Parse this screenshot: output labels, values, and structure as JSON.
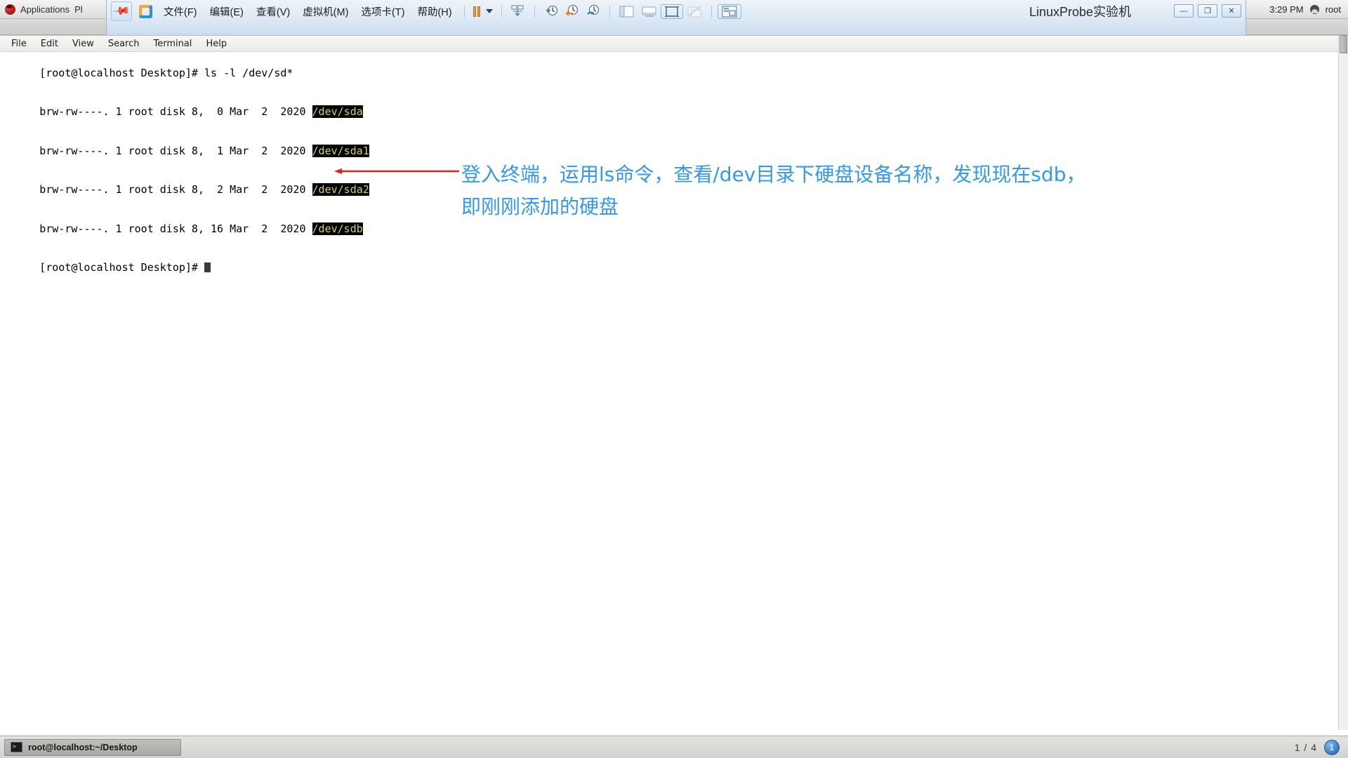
{
  "gnome_panel": {
    "logo_icon": "redhat-logo",
    "applications_label": "Applications",
    "places_label": "Pl",
    "clock": "3:29 PM",
    "user": "root",
    "user_icon": "user-icon"
  },
  "vmware": {
    "pin_icon": "pin-icon",
    "app_icon": "vmware-app-icon",
    "menus": [
      {
        "label": "文件(F)",
        "accel": "F"
      },
      {
        "label": "编辑(E)",
        "accel": "E"
      },
      {
        "label": "查看(V)",
        "accel": "V"
      },
      {
        "label": "虚拟机(M)",
        "accel": "M"
      },
      {
        "label": "选项卡(T)",
        "accel": "T"
      },
      {
        "label": "帮助(H)",
        "accel": "H"
      }
    ],
    "toolbar_icons": [
      "pause-icon",
      "dropdown-caret-icon",
      "send-ctrl-alt-del-icon",
      "snapshot-add-icon",
      "snapshot-revert-icon",
      "snapshot-manager-icon",
      "show-sidebar-icon",
      "show-console-view-icon",
      "fullscreen-icon",
      "unity-mode-icon",
      "show-library-icon"
    ],
    "vm_title": "LinuxProbe实验机",
    "window_buttons": [
      "minimize-button",
      "restore-button",
      "close-button"
    ],
    "minimize_glyph": "—",
    "restore_glyph": "❐",
    "close_glyph": "✕"
  },
  "guest_window": {
    "title": "root@localhost:~/Desktop",
    "min_glyph": "—",
    "max_glyph": "❐",
    "close_glyph": "✕"
  },
  "terminal": {
    "menus": [
      "File",
      "Edit",
      "View",
      "Search",
      "Terminal",
      "Help"
    ],
    "lines": [
      {
        "text": "[root@localhost Desktop]# ls -l /dev/sd*",
        "highlight": ""
      },
      {
        "text": "brw-rw----. 1 root disk 8,  0 Mar  2  2020 ",
        "highlight": "/dev/sda"
      },
      {
        "text": "brw-rw----. 1 root disk 8,  1 Mar  2  2020 ",
        "highlight": "/dev/sda1"
      },
      {
        "text": "brw-rw----. 1 root disk 8,  2 Mar  2  2020 ",
        "highlight": "/dev/sda2"
      },
      {
        "text": "brw-rw----. 1 root disk 8, 16 Mar  2  2020 ",
        "highlight": "/dev/sdb"
      }
    ],
    "prompt": "[root@localhost Desktop]# ",
    "cursor": "block-cursor"
  },
  "annotation": {
    "line1": "登入终端，运用ls命令，查看/dev目录下硬盘设备名称，发现现在sdb，",
    "line2": "即刚刚添加的硬盘",
    "color": "#3399ee",
    "arrow_color": "#e8201a",
    "arrow_icon": "left-arrow-pointer"
  },
  "taskbar": {
    "window_button": {
      "icon": "terminal-icon",
      "label": "root@localhost:~/Desktop"
    },
    "pager": "1 / 4",
    "workspace": "1"
  }
}
